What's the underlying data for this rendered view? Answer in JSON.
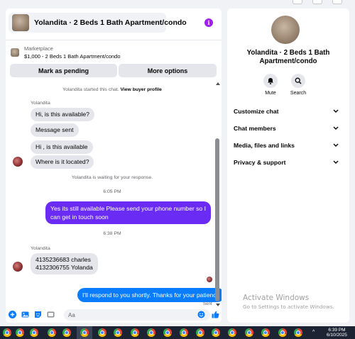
{
  "listing": {
    "title": "Yolandita · 2 Beds 1 Bath Apartment/condo",
    "info_icon": "i",
    "marketplace_label": "Marketplace",
    "marketplace_detail": "$1,000 - 2 Beds 1 Bath Apartment/condo",
    "btn_pending": "Mark as pending",
    "btn_more": "More options"
  },
  "messages": {
    "started_prefix": "Yolandita started this chat.",
    "started_link": "View buyer profile",
    "sender1": "Yolandita",
    "m1": "Hi, is this available?",
    "m2": "Message sent",
    "m3": "Hi , is this available",
    "m4": "Where is it located?",
    "waiting": "Yolandita is waiting for your response.",
    "time1": "6:05 PM",
    "out1": "Yes its still available Please send your phone number so I can get in touch soon",
    "time2": "6:38 PM",
    "sender2": "Yolandita",
    "in_phone_1": "4135236683 charles",
    "in_phone_2": "4132306755 Yolanda",
    "out2": "I'll respond to you shortly. Thanks for your patience",
    "sent": "Sent"
  },
  "composer": {
    "placeholder": "Aa",
    "icons": [
      "plus-circle-icon",
      "photo-icon",
      "sticker-icon",
      "gif-icon",
      "emoji-icon",
      "thumbs-up-icon"
    ]
  },
  "info_panel": {
    "title": "Yolandita · 2 Beds 1 Bath Apartment/condo",
    "mute": "Mute",
    "search": "Search",
    "rows": [
      "Customize chat",
      "Chat members",
      "Media, files and links",
      "Privacy & support"
    ]
  },
  "watermark": {
    "title": "Activate Windows",
    "subtitle": "Go to Settings to activate Windows."
  },
  "taskbar": {
    "time": "6:39 PM",
    "date": "6/10/2025",
    "tray_caret": "^"
  },
  "colors": {
    "accent_blue": "#0a7cff",
    "accent_purple": "#6a2cf5",
    "info_purple": "#a020f0"
  }
}
